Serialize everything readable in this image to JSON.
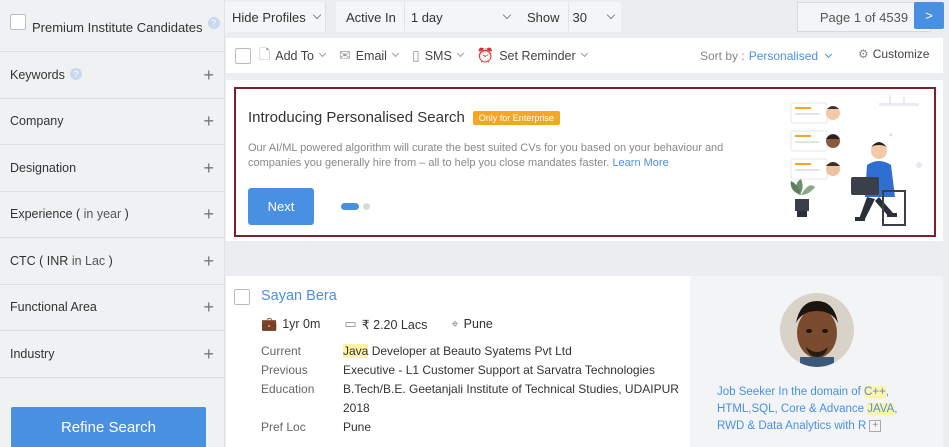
{
  "sidebar": {
    "premium_label": "Premium Institute Candidates",
    "filters": [
      {
        "label": "Keywords",
        "sub": "",
        "help": true
      },
      {
        "label": "Company",
        "sub": ""
      },
      {
        "label": "Designation",
        "sub": ""
      },
      {
        "label": "Experience ( ",
        "sub": "in year",
        "suffix": " )"
      },
      {
        "label": "CTC ( INR ",
        "sub": "in Lac",
        "suffix": " )"
      },
      {
        "label": "Functional Area",
        "sub": ""
      },
      {
        "label": "Industry",
        "sub": ""
      }
    ],
    "refine_label": "Refine Search"
  },
  "topbar": {
    "hide_profiles": "Hide Profiles",
    "active_in_label": "Active In",
    "active_in_value": "1 day",
    "show_label": "Show",
    "show_value": "30",
    "page_text": "Page 1 of 4539",
    "next_label": ">"
  },
  "actionbar": {
    "add_to": "Add To",
    "email": "Email",
    "sms": "SMS",
    "set_reminder": "Set Reminder",
    "sort_by_label": "Sort by :",
    "sort_by_value": "Personalised",
    "customize": "Customize"
  },
  "promo": {
    "title": "Introducing Personalised Search",
    "badge": "Only for Enterprise",
    "description": "Our AI/ML powered algorithm will curate the best suited CVs for you based on your behaviour and companies you generally hire from – all to help you close mandates faster.",
    "learn_more": "Learn More",
    "next_label": "Next"
  },
  "candidate": {
    "name": "Sayan Bera",
    "experience": "1yr 0m",
    "ctc": "₹ 2.20 Lacs",
    "location": "Pune",
    "current_label": "Current",
    "current_hl": "Java",
    "current_rest": " Developer at Beauto Syatems Pvt Ltd",
    "previous_label": "Previous",
    "previous_value": "Executive - L1 Customer Support at Sarvatra Technologies",
    "education_label": "Education",
    "education_value": "B.Tech/B.E. Geetanjali Institute of Technical Studies, UDAIPUR 2018",
    "pref_loc_label": "Pref Loc",
    "pref_loc_value": "Pune",
    "summary_a": "Job Seeker In the domain of ",
    "summary_hl1": "C++",
    "summary_b": ", HTML,SQL, Core & Advance ",
    "summary_hl2": "JAVA",
    "summary_c": ", RWD & Data Analytics with R",
    "expand_label": "+"
  },
  "colors": {
    "accent": "#4a90e2",
    "badge": "#f5a623",
    "promo_border": "#7a1f2e",
    "highlight": "#fff3a6"
  }
}
